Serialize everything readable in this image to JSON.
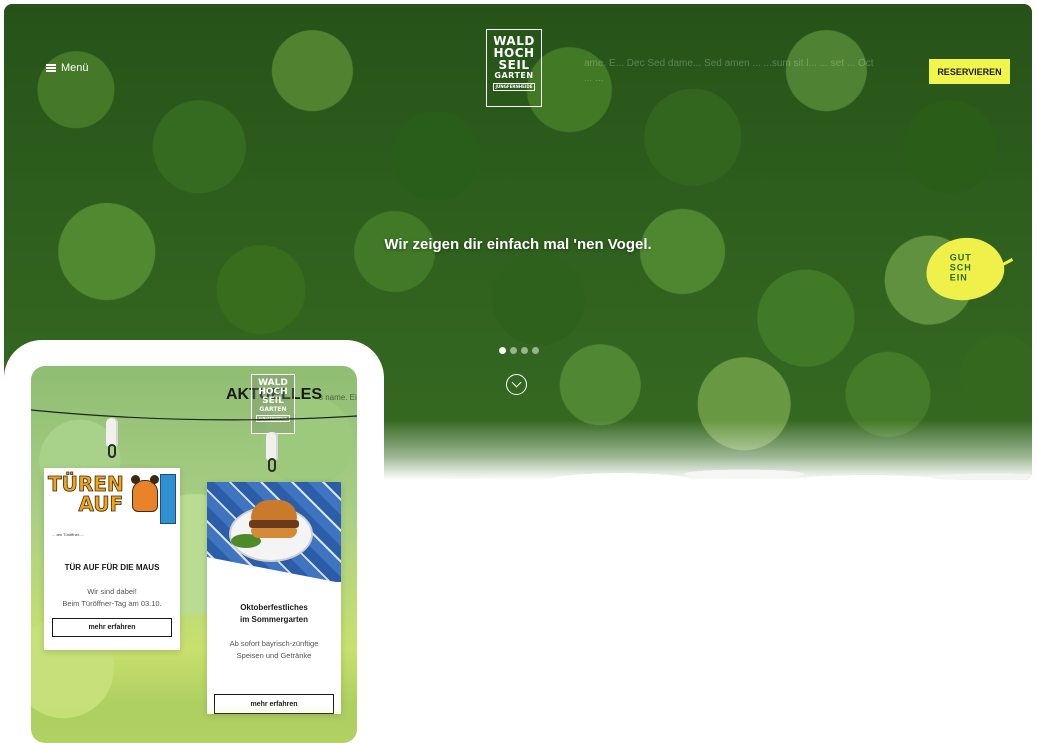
{
  "desktop": {
    "menu_label": "Menü",
    "logo_lines": [
      "WALD",
      "HOCH",
      "SEIL",
      "GARTEN"
    ],
    "logo_sub": "JUNGFERNHEIDE",
    "ghost_text": "ame. E... Dec Sed dame... Sed amen ... ...sum sit l... ... set ... Oct ... ...",
    "reserve_label": "RESERVIEREN",
    "hero_text": "Wir zeigen dir einfach mal 'nen Vogel.",
    "voucher_lines": [
      "GUT",
      "SCH",
      "EIN"
    ],
    "slider": {
      "count": 4,
      "active": 1
    }
  },
  "mobile": {
    "title": "AKTUELLES",
    "title_ghost": "s name. Ei",
    "logo_lines": [
      "WALD",
      "HOCH",
      "SEIL",
      "GARTEN"
    ],
    "logo_sub": "JUNGFERNHEIDE",
    "cards": [
      {
        "image_title_1": "TÜREN",
        "image_title_2": "AUF",
        "image_caption": "... am Türöffner-...",
        "title_lines": [
          "TÜR AUF FÜR DIE MAUS"
        ],
        "text_lines": [
          "Wir sind dabei!",
          "Beim Türöffner-Tag am 03.10."
        ],
        "button_label": "mehr erfahren"
      },
      {
        "title_lines": [
          "Oktoberfestliches",
          "im Sommergarten"
        ],
        "text_lines": [
          "Ab sofort bayrisch-zünftige",
          "Speisen und Getränke"
        ],
        "button_label": "mehr erfahren"
      }
    ]
  }
}
